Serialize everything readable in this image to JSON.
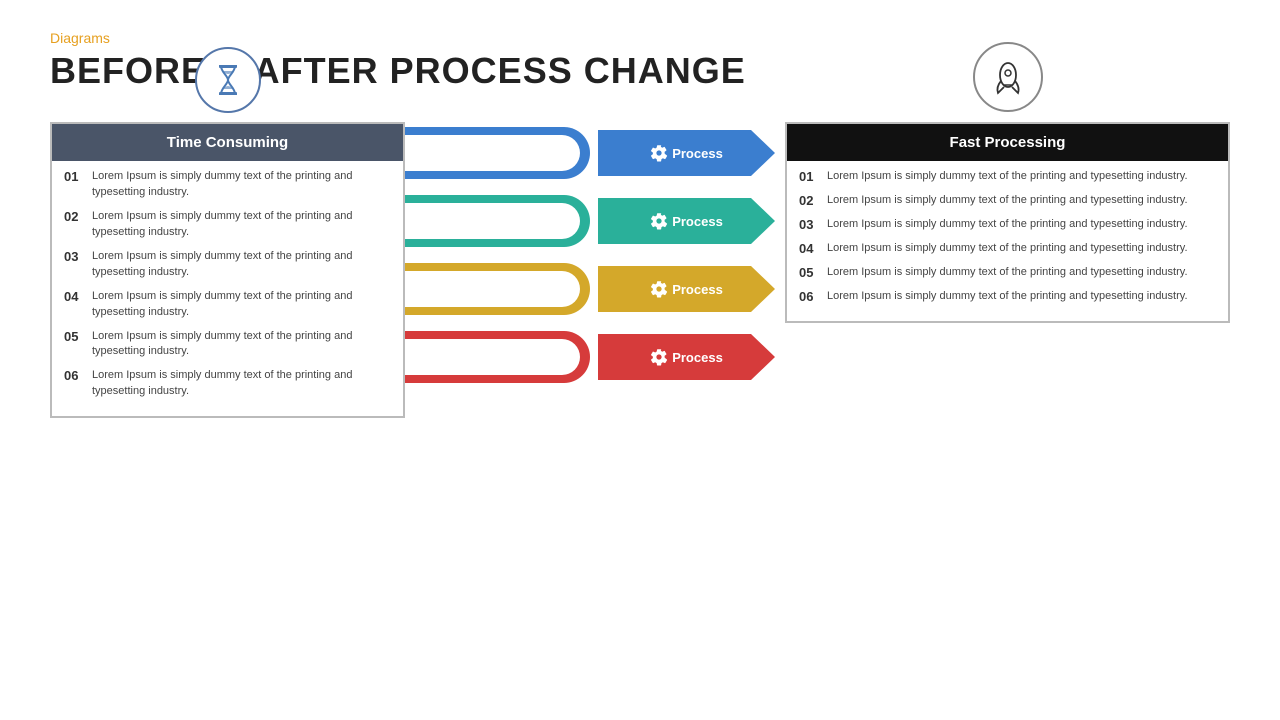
{
  "header": {
    "tag": "Diagrams",
    "title": "BEFORE & AFTER PROCESS CHANGE"
  },
  "left_panel": {
    "icon_label": "hourglass",
    "header": "Time Consuming",
    "items": [
      {
        "num": "01",
        "text": "Lorem Ipsum is simply dummy text of the printing and typesetting industry."
      },
      {
        "num": "02",
        "text": "Lorem Ipsum is simply dummy text of the printing and typesetting industry."
      },
      {
        "num": "03",
        "text": "Lorem Ipsum is simply dummy text of the printing and typesetting industry."
      },
      {
        "num": "04",
        "text": "Lorem Ipsum is simply dummy text of the printing and typesetting industry."
      },
      {
        "num": "05",
        "text": "Lorem Ipsum is simply dummy text of the printing and typesetting industry."
      },
      {
        "num": "06",
        "text": "Lorem Ipsum is simply dummy text of the printing and typesetting industry."
      }
    ]
  },
  "center_arrows": [
    {
      "label": "Process",
      "color": "#3b7ecf",
      "band_color": "#3b7ecf"
    },
    {
      "label": "Process",
      "color": "#2ab09a",
      "band_color": "#2ab09a"
    },
    {
      "label": "Process",
      "color": "#d4a82a",
      "band_color": "#d4a82a"
    },
    {
      "label": "Process",
      "color": "#d63b3b",
      "band_color": "#d63b3b"
    }
  ],
  "right_panel": {
    "icon_label": "rocket",
    "header": "Fast Processing",
    "items": [
      {
        "num": "01",
        "text": "Lorem Ipsum is simply dummy text of the printing and typesetting industry."
      },
      {
        "num": "02",
        "text": "Lorem Ipsum is simply dummy text of the printing and typesetting industry."
      },
      {
        "num": "03",
        "text": "Lorem Ipsum is simply dummy text of the printing and typesetting industry."
      },
      {
        "num": "04",
        "text": "Lorem Ipsum is simply dummy text of the printing and typesetting industry."
      },
      {
        "num": "05",
        "text": "Lorem Ipsum is simply dummy text of the printing and typesetting industry."
      },
      {
        "num": "06",
        "text": "Lorem Ipsum is simply dummy text of the printing and typesetting industry."
      }
    ]
  },
  "colors": {
    "orange": "#e6a020",
    "blue": "#3b7ecf",
    "teal": "#2ab09a",
    "yellow": "#d4a82a",
    "red": "#d63b3b",
    "dark_header": "#4a5568",
    "black_header": "#111111"
  }
}
